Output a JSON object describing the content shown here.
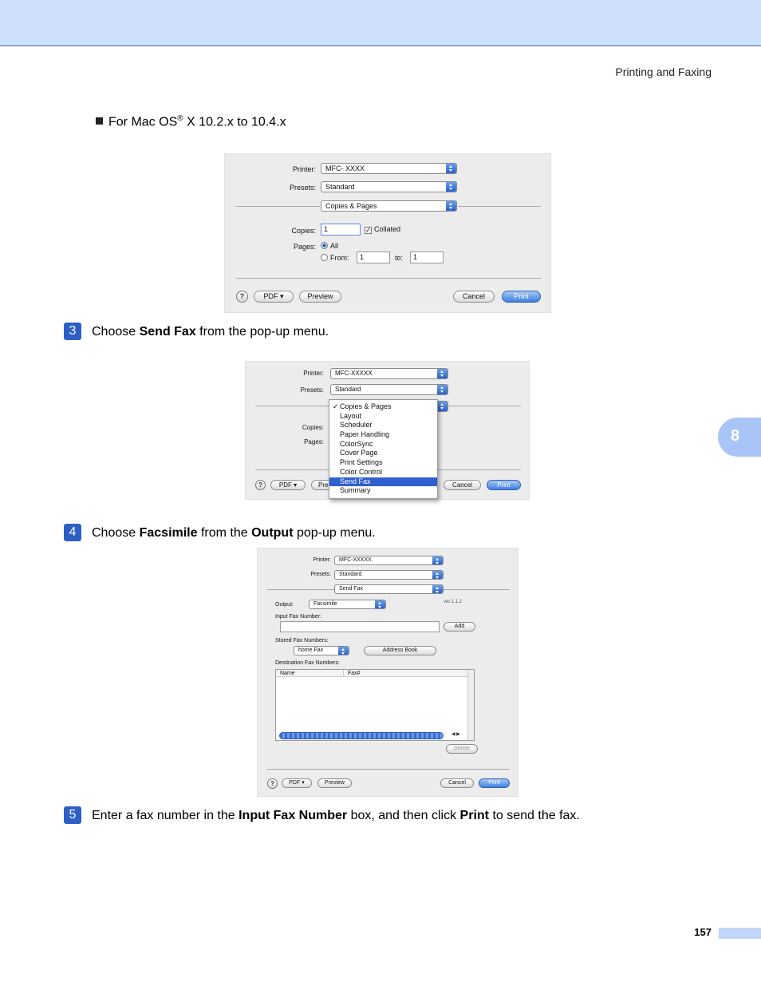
{
  "header": {
    "section": "Printing and Faxing"
  },
  "chapter": "8",
  "footer": {
    "page": "157"
  },
  "bullet": {
    "pre": "For Mac OS",
    "sup": "®",
    "post": " X 10.2.x to 10.4.x"
  },
  "steps": [
    {
      "num": "3",
      "parts": [
        "Choose ",
        "Send Fax",
        " from the pop-up menu."
      ]
    },
    {
      "num": "4",
      "parts": [
        "Choose ",
        "Facsimile",
        " from the ",
        "Output",
        " pop-up menu."
      ]
    },
    {
      "num": "5",
      "parts": [
        "Enter a fax number in the ",
        "Input Fax Number",
        " box, and then click ",
        "Print",
        " to send the fax."
      ]
    }
  ],
  "dialog1": {
    "printer_label": "Printer:",
    "printer": "MFC- XXXX",
    "presets_label": "Presets:",
    "presets": "Standard",
    "panel": "Copies & Pages",
    "copies_label": "Copies:",
    "copies": "1",
    "collated": "Collated",
    "pages_label": "Pages:",
    "all": "All",
    "from_label": "From:",
    "from": "1",
    "to_label": "to:",
    "to": "1",
    "help": "?",
    "pdf": "PDF ▾",
    "preview": "Preview",
    "cancel": "Cancel",
    "print": "Print"
  },
  "dialog2": {
    "printer_label": "Printer:",
    "printer": "MFC-XXXXX",
    "presets_label": "Presets:",
    "presets": "Standard",
    "copies_label": "Copies:",
    "pages_label": "Pages:",
    "menu": [
      "Copies & Pages",
      "Layout",
      "Scheduler",
      "Paper Handling",
      "ColorSync",
      "Cover Page",
      "Print Settings",
      "Color Control",
      "Send Fax",
      "Summary"
    ],
    "checked": "✓",
    "help": "?",
    "pdf": "PDF ▾",
    "preview": "Prev",
    "cancel": "Cancel",
    "print": "Print"
  },
  "dialog3": {
    "printer_label": "Printer:",
    "printer": "MFC-XXXXX",
    "presets_label": "Presets:",
    "presets": "Standard",
    "panel": "Send Fax",
    "output_label": "Output:",
    "output": "Facsimile",
    "version": "ver.1.1.2",
    "input_label": "Input Fax Number:",
    "add": "Add",
    "stored_label": "Stored Fax Numbers:",
    "stored": "home Fax",
    "address_book": "Address Book",
    "dest_label": "Destination Fax Numbers:",
    "col_name": "Name",
    "col_fax": "Fax#",
    "delete": "Delete",
    "help": "?",
    "pdf": "PDF ▾",
    "preview": "Preview",
    "cancel": "Cancel",
    "print": "Print"
  }
}
